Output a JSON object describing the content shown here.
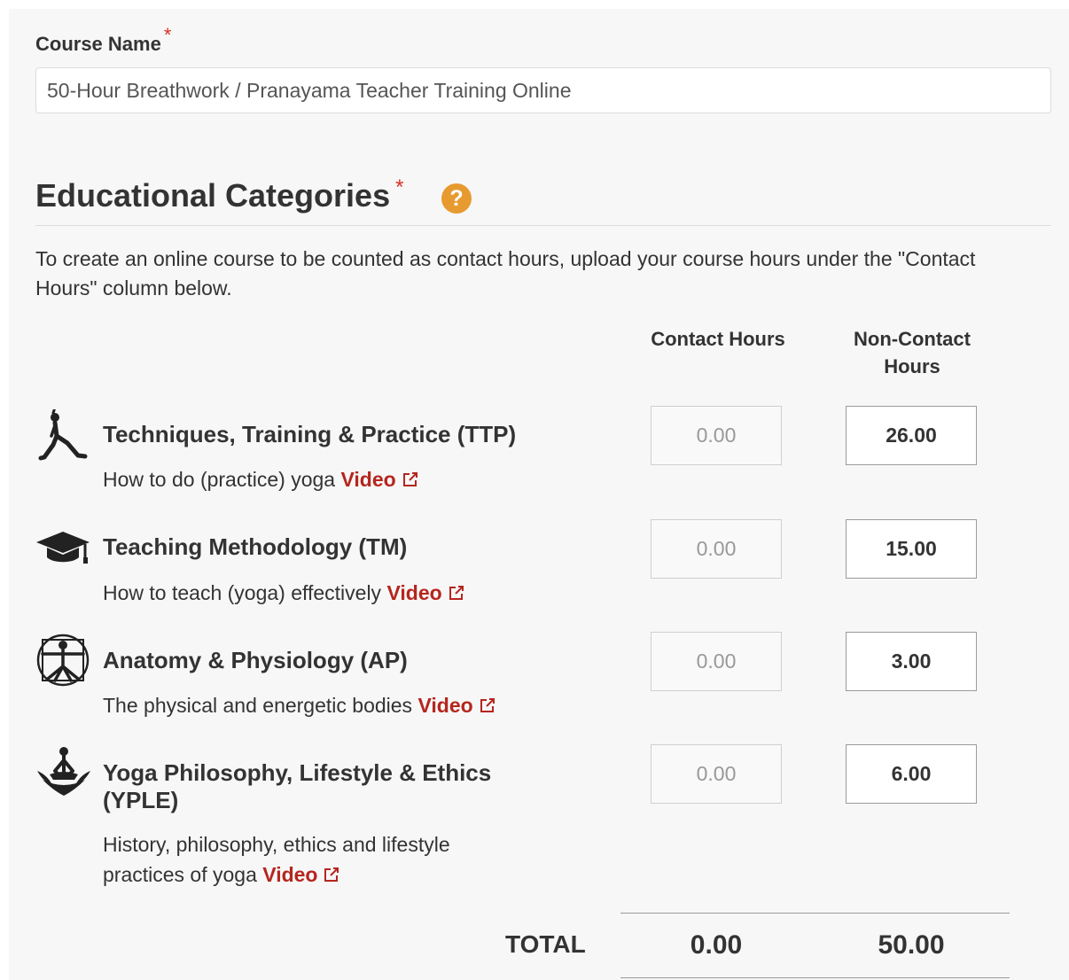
{
  "course": {
    "label": "Course Name",
    "required_mark": "*",
    "value": "50-Hour Breathwork / Pranayama Teacher Training Online"
  },
  "section": {
    "title": "Educational Categories",
    "required_mark": "*",
    "help_glyph": "?",
    "intro": "To create an online course to be counted as contact hours, upload your course hours under the \"Contact Hours\" column below."
  },
  "columns": {
    "contact": "Contact Hours",
    "noncontact": "Non-Contact Hours"
  },
  "categories": [
    {
      "icon": "yoga-pose-icon",
      "title": "Techniques, Training & Practice (TTP)",
      "description": "How to do (practice) yoga",
      "link": "Video",
      "contact": "0.00",
      "noncontact": "26.00"
    },
    {
      "icon": "graduation-cap-icon",
      "title": "Teaching Methodology (TM)",
      "description": "How to teach (yoga) effectively",
      "link": "Video",
      "contact": "0.00",
      "noncontact": "15.00"
    },
    {
      "icon": "vitruvian-man-icon",
      "title": "Anatomy & Physiology (AP)",
      "description": "The physical and energetic bodies",
      "link": "Video",
      "contact": "0.00",
      "noncontact": "3.00"
    },
    {
      "icon": "lotus-meditation-icon",
      "title_line1": "Yoga Philosophy, Lifestyle & Ethics",
      "title_line2": "(YPLE)",
      "description_line1": "History, philosophy, ethics and lifestyle",
      "description_line2": "practices of yoga",
      "link": "Video",
      "contact": "0.00",
      "noncontact": "6.00"
    }
  ],
  "total": {
    "label": "TOTAL",
    "contact": "0.00",
    "noncontact": "50.00"
  },
  "colors": {
    "accent_link": "#b5261e",
    "required": "#d93025",
    "help": "#e79a2f"
  }
}
